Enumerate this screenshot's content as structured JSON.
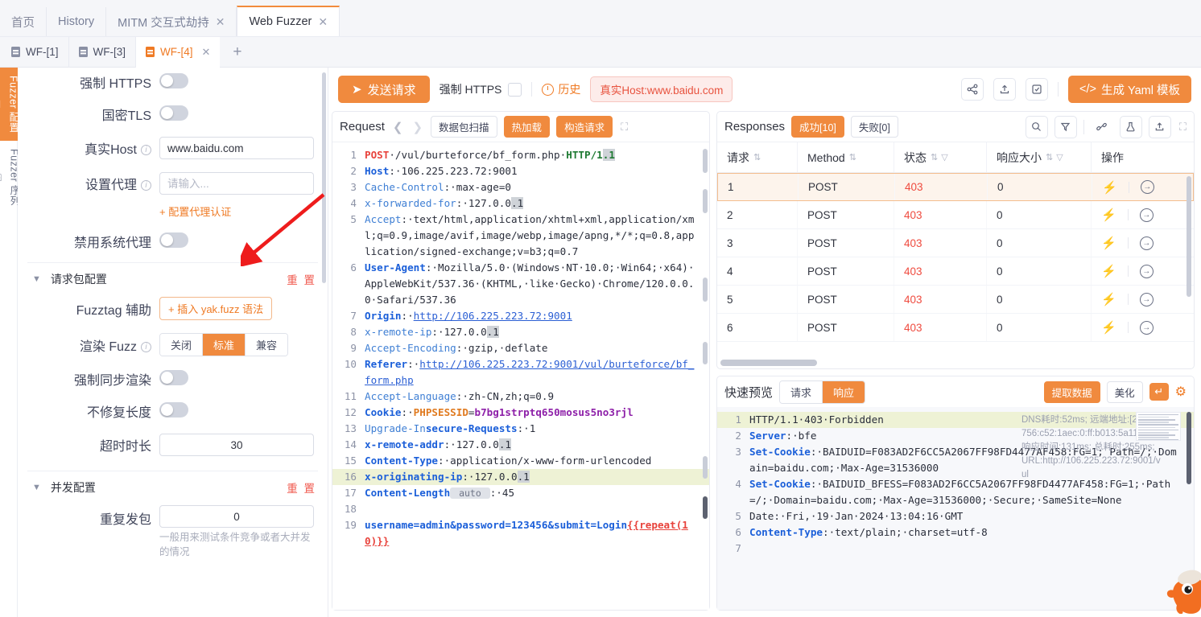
{
  "window_tabs": [
    {
      "label": "首页",
      "closable": false,
      "active": false
    },
    {
      "label": "History",
      "closable": false,
      "active": false
    },
    {
      "label": "MITM 交互式劫持",
      "closable": true,
      "active": false
    },
    {
      "label": "Web Fuzzer",
      "closable": true,
      "active": true
    }
  ],
  "sub_tabs": [
    {
      "label": "WF-[1]",
      "active": false,
      "closable": false
    },
    {
      "label": "WF-[3]",
      "active": false,
      "closable": false
    },
    {
      "label": "WF-[4]",
      "active": true,
      "closable": true
    }
  ],
  "add_tab_label": "+",
  "rail": [
    {
      "label": "Fuzzer 配置",
      "icon": "sliders-icon",
      "active": true
    },
    {
      "label": "Fuzzer 序列",
      "icon": "stack-icon",
      "active": false
    }
  ],
  "config": {
    "force_https": {
      "label": "强制 HTTPS",
      "on": false
    },
    "gm_tls": {
      "label": "国密TLS",
      "on": false
    },
    "real_host": {
      "label": "真实Host",
      "value": "www.baidu.com",
      "has_info": true
    },
    "proxy": {
      "label": "设置代理",
      "value": "",
      "placeholder": "请输入...",
      "has_info": true
    },
    "proxy_auth_link": "+ 配置代理认证",
    "disable_sys_proxy": {
      "label": "禁用系统代理",
      "on": false
    },
    "section_request": {
      "title": "请求包配置",
      "reset": "重 置",
      "fuzztag": {
        "label": "Fuzztag 辅助",
        "button": "+ 插入 yak.fuzz 语法"
      },
      "render_fuzz": {
        "label": "渲染 Fuzz",
        "options": [
          "关闭",
          "标准",
          "兼容"
        ],
        "selected": "标准",
        "has_info": true
      },
      "force_sync_render": {
        "label": "强制同步渲染",
        "on": false
      },
      "no_fix_length": {
        "label": "不修复长度",
        "on": false
      },
      "timeout": {
        "label": "超时时长",
        "value": "30"
      }
    },
    "section_concurrency": {
      "title": "并发配置",
      "reset": "重 置",
      "repeat": {
        "label": "重复发包",
        "value": "0",
        "hint": "一般用来测试条件竞争或者大并发的情况"
      }
    }
  },
  "toolbar": {
    "send_label": "发送请求",
    "send_icon": "send-icon",
    "force_https_label": "强制 HTTPS",
    "force_https_checked": false,
    "history_label": "历史",
    "history_icon": "clock-icon",
    "host_badge": "真实Host:www.baidu.com",
    "icons": [
      "share-icon",
      "upload-icon",
      "edit-icon"
    ],
    "yaml_label": "生成 Yaml 模板",
    "yaml_icon": "code-icon"
  },
  "request_panel": {
    "title": "Request",
    "prev_icon": "chevron-left-icon",
    "next_icon": "chevron-right-icon",
    "buttons": [
      {
        "label": "数据包扫描",
        "solid": false
      },
      {
        "label": "热加载",
        "solid": true
      },
      {
        "label": "构造请求",
        "solid": true
      }
    ],
    "expand_icon": "expand-icon",
    "lines": [
      {
        "n": 1,
        "segs": [
          {
            "t": "POST",
            "c": "k-method"
          },
          {
            "t": "·/vul/burteforce/bf_form.php·",
            "c": "k-val"
          },
          {
            "t": "HTTP/1",
            "c": "k-proto"
          },
          {
            "t": ".1",
            "c": "k-proto hl"
          }
        ]
      },
      {
        "n": 2,
        "segs": [
          {
            "t": "Host",
            "c": "k-hdr"
          },
          {
            "t": ":·106.225.223.72:9001",
            "c": "k-val"
          }
        ]
      },
      {
        "n": 3,
        "segs": [
          {
            "t": "Cache-Control",
            "c": "k-hdr2"
          },
          {
            "t": ":·max-age=0",
            "c": "k-val"
          }
        ]
      },
      {
        "n": 4,
        "segs": [
          {
            "t": "x-forwarded-for",
            "c": "k-hdr2"
          },
          {
            "t": ":·127.0.0",
            "c": "k-val"
          },
          {
            "t": ".1",
            "c": "k-val hl"
          }
        ]
      },
      {
        "n": 5,
        "segs": [
          {
            "t": "Accept",
            "c": "k-hdr2"
          },
          {
            "t": ":·text/html,application/xhtml+xml,application/xml;q=0.9,image/avif,image/webp,image/apng,*/*;q=0.8,application/signed-exchange;v=b3;q=0.7",
            "c": "k-val"
          }
        ]
      },
      {
        "n": 6,
        "segs": [
          {
            "t": "User-Agent",
            "c": "k-hdr"
          },
          {
            "t": ":·Mozilla/5.0·(Windows·NT·10.0;·Win64;·x64)·AppleWebKit/537.36·(KHTML,·like·Gecko)·Chrome/120.0.0.0·Safari/537.36",
            "c": "k-val"
          }
        ]
      },
      {
        "n": 7,
        "segs": [
          {
            "t": "Origin",
            "c": "k-hdr"
          },
          {
            "t": ":·",
            "c": "k-val"
          },
          {
            "t": "http://106.225.223.72:9001",
            "c": "k-url"
          }
        ]
      },
      {
        "n": 8,
        "segs": [
          {
            "t": "x-remote-ip",
            "c": "k-hdr2"
          },
          {
            "t": ":·127.0.0",
            "c": "k-val"
          },
          {
            "t": ".1",
            "c": "k-val hl"
          }
        ]
      },
      {
        "n": 9,
        "segs": [
          {
            "t": "Accept-Encoding",
            "c": "k-hdr2"
          },
          {
            "t": ":·gzip,·deflate",
            "c": "k-val"
          }
        ]
      },
      {
        "n": 10,
        "segs": [
          {
            "t": "Referer",
            "c": "k-hdr"
          },
          {
            "t": ":·",
            "c": "k-val"
          },
          {
            "t": "http://106.225.223.72:9001/vul/burteforce/bf_form.php",
            "c": "k-url"
          }
        ]
      },
      {
        "n": 11,
        "segs": [
          {
            "t": "Accept-Language",
            "c": "k-hdr2"
          },
          {
            "t": ":·zh-CN,zh;q=0.9",
            "c": "k-val"
          }
        ]
      },
      {
        "n": 12,
        "segs": [
          {
            "t": "Cookie",
            "c": "k-hdr"
          },
          {
            "t": ":·",
            "c": "k-val"
          },
          {
            "t": "PHPSESSID",
            "c": "k-cookie-k"
          },
          {
            "t": "=",
            "c": "k-val"
          },
          {
            "t": "b7bg1strptq650mosus5no3rjl",
            "c": "k-cookie-v"
          }
        ]
      },
      {
        "n": 13,
        "segs": [
          {
            "t": "Upgrade-In",
            "c": "k-hdr2"
          },
          {
            "t": "secure-Requests",
            "c": "k-hdr"
          },
          {
            "t": ":·1",
            "c": "k-val"
          }
        ]
      },
      {
        "n": 14,
        "segs": [
          {
            "t": "x-remote-addr",
            "c": "k-hdr"
          },
          {
            "t": ":·127.0.0",
            "c": "k-val"
          },
          {
            "t": ".1",
            "c": "k-val hl"
          }
        ]
      },
      {
        "n": 15,
        "segs": [
          {
            "t": "Content-Type",
            "c": "k-hdr"
          },
          {
            "t": ":·application/x-www-form-urlencoded",
            "c": "k-val"
          }
        ]
      },
      {
        "n": 16,
        "highlight": true,
        "segs": [
          {
            "t": "x-originating-ip",
            "c": "k-hdr"
          },
          {
            "t": ":·127.0.0",
            "c": "k-val"
          },
          {
            "t": ".1",
            "c": "k-val hl"
          }
        ]
      },
      {
        "n": 17,
        "segs": [
          {
            "t": "Content-Length",
            "c": "k-hdr"
          },
          {
            "t": " auto ",
            "c": "chip"
          },
          {
            "t": ":·45",
            "c": "k-val"
          }
        ]
      },
      {
        "n": 18,
        "segs": []
      },
      {
        "n": 19,
        "segs": [
          {
            "t": "username=admin&password=123456&submit=Login",
            "c": "k-body"
          },
          {
            "t": "{{repeat(10)}}",
            "c": "k-fuzz"
          }
        ]
      }
    ]
  },
  "responses_panel": {
    "title": "Responses",
    "tabs": [
      {
        "label": "成功[10]",
        "active": true
      },
      {
        "label": "失败[0]",
        "active": false
      }
    ],
    "icons": [
      "search-icon",
      "filter-icon",
      "chain-icon",
      "flask-icon",
      "upload-icon",
      "expand-icon"
    ],
    "columns": [
      {
        "label": "请求",
        "sortable": true,
        "filterable": false
      },
      {
        "label": "Method",
        "sortable": true,
        "filterable": false
      },
      {
        "label": "状态",
        "sortable": true,
        "filterable": true
      },
      {
        "label": "响应大小",
        "sortable": true,
        "filterable": true
      },
      {
        "label": "操作",
        "sortable": false,
        "filterable": false
      }
    ],
    "rows": [
      {
        "req": "1",
        "method": "POST",
        "status": "403",
        "size": "0",
        "selected": true
      },
      {
        "req": "2",
        "method": "POST",
        "status": "403",
        "size": "0",
        "selected": false
      },
      {
        "req": "3",
        "method": "POST",
        "status": "403",
        "size": "0",
        "selected": false
      },
      {
        "req": "4",
        "method": "POST",
        "status": "403",
        "size": "0",
        "selected": false
      },
      {
        "req": "5",
        "method": "POST",
        "status": "403",
        "size": "0",
        "selected": false
      },
      {
        "req": "6",
        "method": "POST",
        "status": "403",
        "size": "0",
        "selected": false
      }
    ],
    "action_icons": [
      "bolt-icon",
      "arrow-circle-icon"
    ]
  },
  "preview_panel": {
    "title": "快速预览",
    "tabs": [
      {
        "label": "请求",
        "active": false
      },
      {
        "label": "响应",
        "active": true
      }
    ],
    "extract_label": "提取数据",
    "beautify_label": "美化",
    "wrap_icon": "wrap-icon",
    "gear_icon": "gear-icon",
    "overlay": [
      "DNS耗时:52ms; 远端地址:[2408:8",
      "756:c52:1aec:0:ff:b013:5a11]:80;",
      "响应时间:131ms; 总耗时:255ms;",
      "URL:http://106.225.223.72:9001/v",
      "ul"
    ],
    "lines": [
      {
        "n": 1,
        "highlight": true,
        "segs": [
          {
            "t": "HTTP/1.1·403·Forbidden",
            "c": "k-val"
          }
        ]
      },
      {
        "n": 2,
        "segs": [
          {
            "t": "Server",
            "c": "k-hdr"
          },
          {
            "t": ":·bfe",
            "c": "k-val"
          }
        ]
      },
      {
        "n": 3,
        "segs": [
          {
            "t": "Set-Cookie",
            "c": "k-hdr"
          },
          {
            "t": ":·",
            "c": "k-val"
          },
          {
            "t": "BAIDUID=F083AD2F6CC5A2067FF98FD4477AF458:FG=1; Path=/;·Domain=baidu.com;·Max-Age=31536000",
            "c": "k-val"
          }
        ]
      },
      {
        "n": 4,
        "segs": [
          {
            "t": "Set-Cookie",
            "c": "k-hdr"
          },
          {
            "t": ":·",
            "c": "k-val"
          },
          {
            "t": "BAIDUID_BFESS=F083AD2F6CC5A2067FF98FD4477AF458:FG=1;·Path=/;·Domain=baidu.com;·Max-Age=31536000;·Secure;·SameSite=None",
            "c": "k-val"
          }
        ]
      },
      {
        "n": 5,
        "segs": [
          {
            "t": "Date",
            "c": "k-val"
          },
          {
            "t": ":·Fri,·19·Jan·2024·13:04:16·GMT",
            "c": "k-val"
          }
        ]
      },
      {
        "n": 6,
        "segs": [
          {
            "t": "Content-Type",
            "c": "k-hdr"
          },
          {
            "t": ":·text/plain;·charset=utf-8",
            "c": "k-val"
          }
        ]
      },
      {
        "n": 7,
        "segs": []
      }
    ]
  },
  "colors": {
    "accent": "#f08a3e",
    "accent_text": "#ef7a24",
    "error": "#ef4b3f",
    "annotation_arrow": "#ee1c1c",
    "link": "#2b5fd4"
  }
}
